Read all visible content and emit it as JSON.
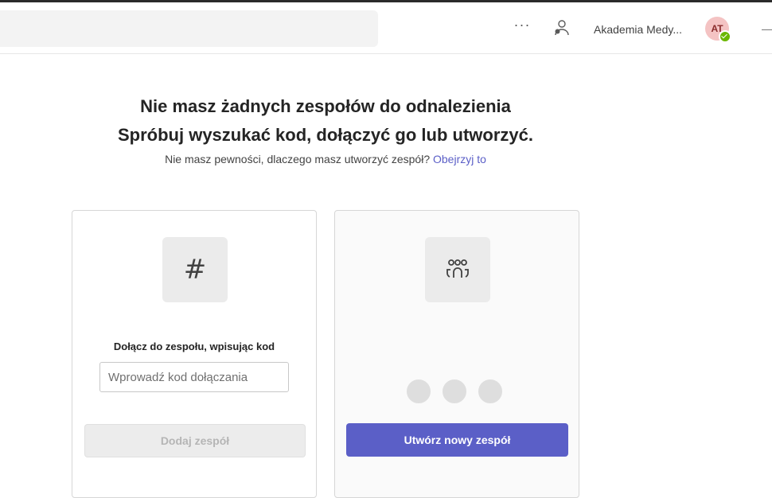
{
  "header": {
    "more_label": "···",
    "org_name": "Akademia Medy...",
    "avatar_initials": "AT"
  },
  "main": {
    "title_line1": "Nie masz żadnych zespołów do odnalezienia",
    "title_line2": "Spróbuj wyszukać kod, dołączyć go lub utworzyć.",
    "subtitle_text": "Nie masz pewności, dlaczego masz utworzyć zespół?",
    "subtitle_link": "Obejrzyj to"
  },
  "join_card": {
    "icon_glyph": "#",
    "label": "Dołącz do zespołu, wpisując kod",
    "input_placeholder": "Wprowadź kod dołączania",
    "input_value": "",
    "button_label": "Dodaj zespół"
  },
  "create_card": {
    "button_label": "Utwórz nowy zespół"
  },
  "icons": {
    "people": "people-icon",
    "teams": "teams-icon",
    "hash": "hash-icon"
  },
  "colors": {
    "accent": "#5b5fc7",
    "presence": "#6bb700",
    "avatar_bg": "#f4c3c3"
  }
}
